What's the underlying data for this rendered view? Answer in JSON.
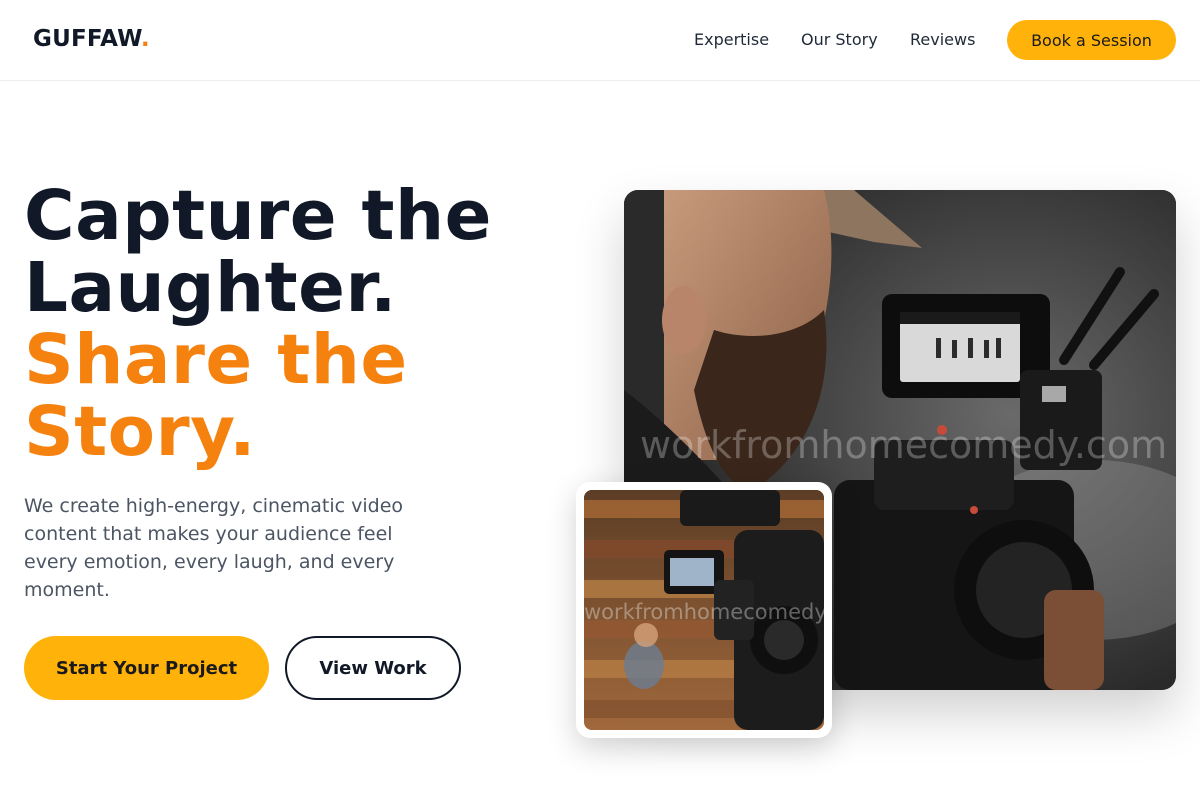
{
  "header": {
    "logo_text": "GUFFAW",
    "logo_dot": ".",
    "nav": [
      "Expertise",
      "Our Story",
      "Reviews"
    ],
    "cta_label": "Book a Session"
  },
  "hero": {
    "title_line1": "Capture the",
    "title_line2": "Laughter.",
    "title_line3": "Share the",
    "title_line4": "Story.",
    "subtitle": "We create high-energy, cinematic video content that makes your audience feel every emotion, every laugh, and every moment.",
    "primary_cta": "Start Your Project",
    "secondary_cta": "View Work"
  },
  "images": {
    "main_watermark": "workfromhomecomedy.com",
    "inset_watermark": "workfromhomecomedy.com"
  },
  "colors": {
    "accent_orange": "#f5820f",
    "button_yellow": "#ffb30a",
    "text_dark": "#111827",
    "text_muted": "#4b5563"
  }
}
